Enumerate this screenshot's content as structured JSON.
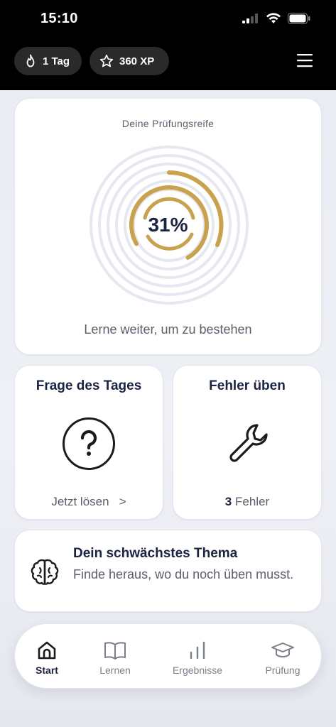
{
  "status_bar": {
    "time": "15:10"
  },
  "header": {
    "streak": {
      "label": "1 Tag",
      "icon": "flame-icon"
    },
    "xp": {
      "label": "360 XP",
      "icon": "star-icon"
    },
    "menu_icon": "hamburger-menu-icon"
  },
  "readiness": {
    "title": "Deine Prüfungsreife",
    "percent_label": "31%",
    "percent_value": 31,
    "subtitle": "Lerne weiter, um zu bestehen",
    "accent_color": "#c9a24f",
    "track_color": "#e6e8f0"
  },
  "question_of_day": {
    "title": "Frage des Tages",
    "action_label": "Jetzt lösen",
    "action_chevron": ">",
    "icon": "question-circle-icon"
  },
  "mistakes": {
    "title": "Fehler üben",
    "count": "3",
    "count_label": "Fehler",
    "icon": "wrench-icon"
  },
  "weakest_topic": {
    "title": "Dein schwächstes Thema",
    "description": "Finde heraus, wo du noch üben musst.",
    "icon": "brain-icon"
  },
  "bottom_nav": {
    "items": [
      {
        "label": "Start",
        "icon": "home-icon",
        "active": true
      },
      {
        "label": "Lernen",
        "icon": "book-icon",
        "active": false
      },
      {
        "label": "Ergebnisse",
        "icon": "bar-chart-icon",
        "active": false
      },
      {
        "label": "Prüfung",
        "icon": "graduation-cap-icon",
        "active": false
      }
    ]
  }
}
